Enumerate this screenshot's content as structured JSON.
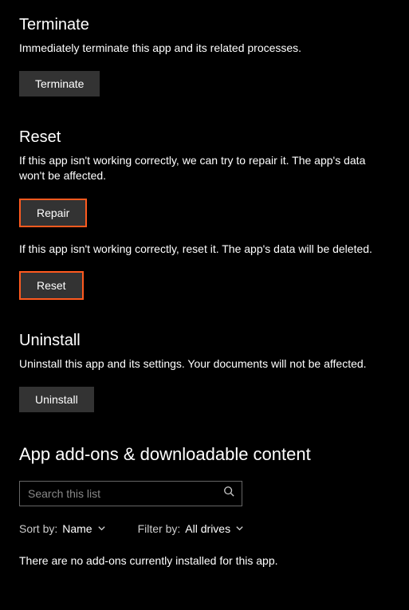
{
  "terminate": {
    "title": "Terminate",
    "description": "Immediately terminate this app and its related processes.",
    "button": "Terminate"
  },
  "reset": {
    "title": "Reset",
    "repair_description": "If this app isn't working correctly, we can try to repair it. The app's data won't be affected.",
    "repair_button": "Repair",
    "reset_description": "If this app isn't working correctly, reset it. The app's data will be deleted.",
    "reset_button": "Reset"
  },
  "uninstall": {
    "title": "Uninstall",
    "description": "Uninstall this app and its settings. Your documents will not be affected.",
    "button": "Uninstall"
  },
  "addons": {
    "title": "App add-ons & downloadable content",
    "search_placeholder": "Search this list",
    "sort_label": "Sort by:",
    "sort_value": "Name",
    "filter_label": "Filter by:",
    "filter_value": "All drives",
    "empty_message": "There are no add-ons currently installed for this app."
  }
}
